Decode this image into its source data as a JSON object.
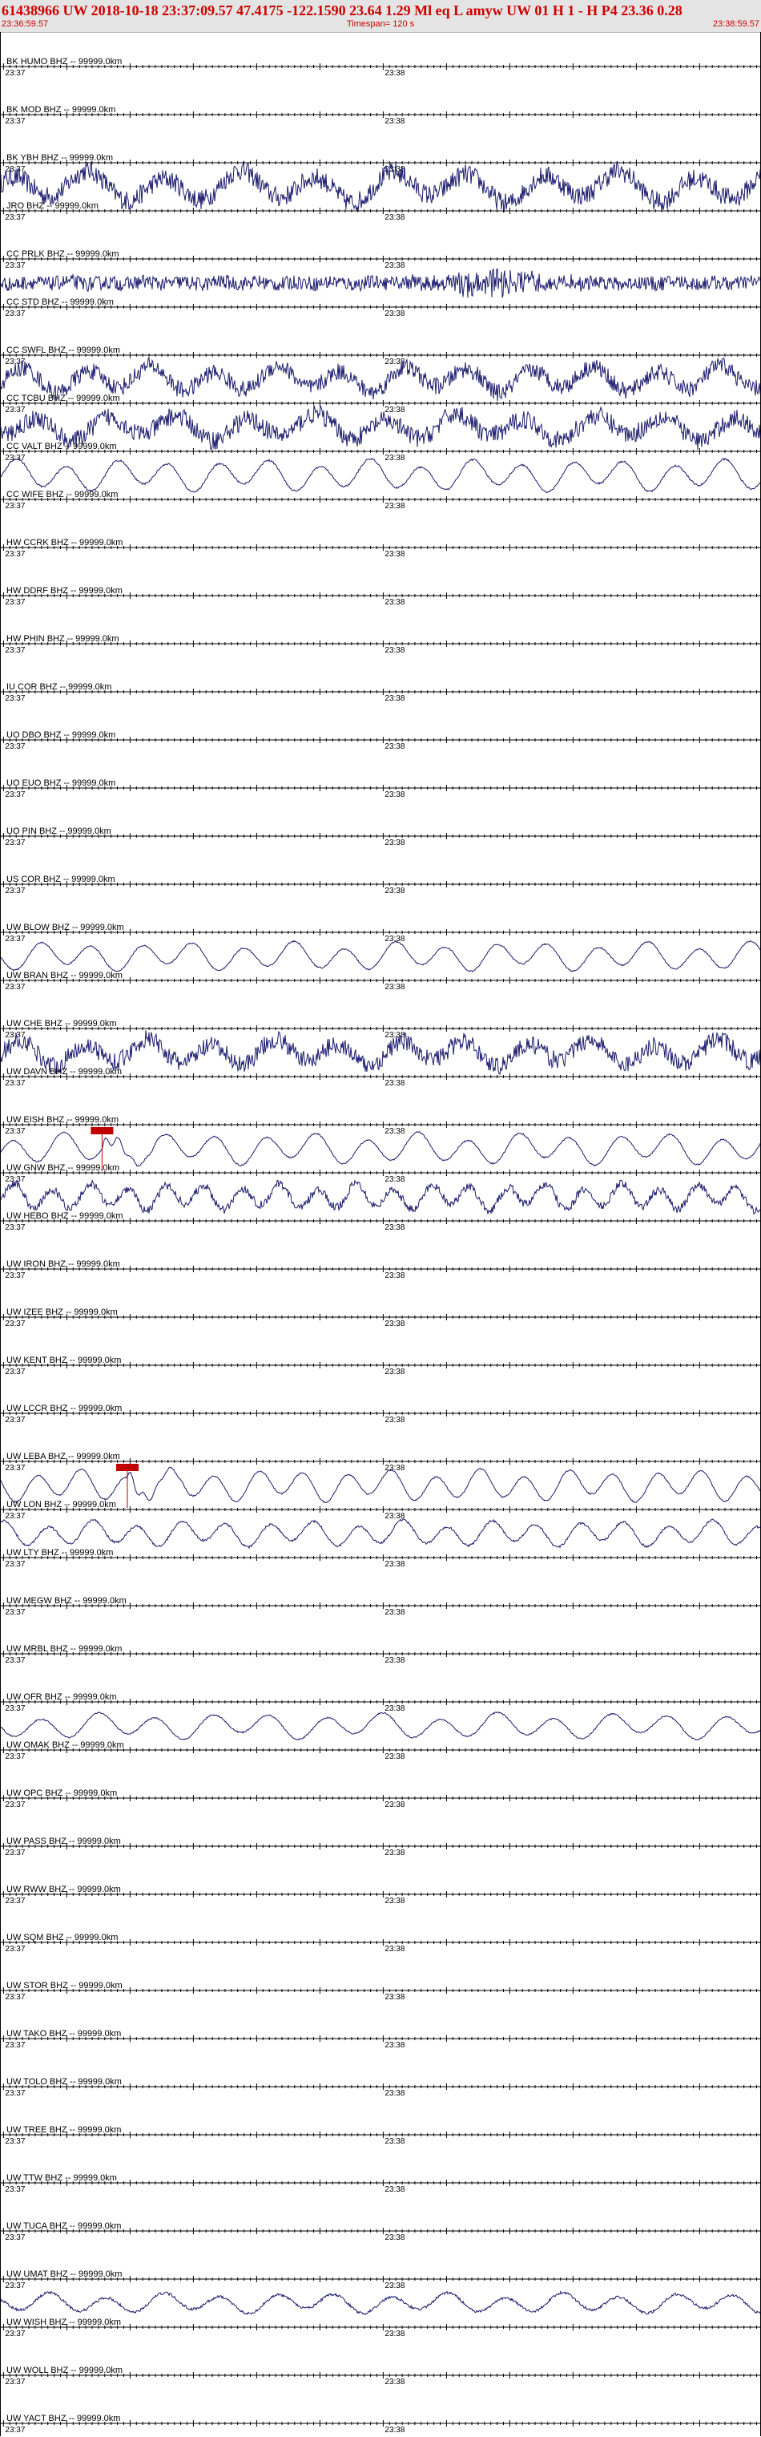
{
  "header": {
    "event_line": "61438966 UW 2018-10-18 23:37:09.57   47.4175 -122.1590  23.64  1.29 Ml  eq  L amyw    UW 01  H   1  -  H P4   23.36  0.28",
    "start_time": "23:36:59.57",
    "timespan": "Timespan= 120 s",
    "end_time": "23:38:59.57"
  },
  "colors": {
    "header_text": "#d00000",
    "header_bg": "#e4e4e4",
    "trace": "#1c1c6e",
    "axis": "#000000",
    "pick": "#c00000"
  },
  "chart_data": {
    "type": "line",
    "title": "61438966 UW 2018-10-18 23:37:09.57",
    "x_axis": {
      "start": "23:36:59.57",
      "end": "23:38:59.57",
      "span_seconds": 120,
      "labels": [
        {
          "text": "23:37",
          "t": 0.43
        },
        {
          "text": "23:38",
          "t": 60.43
        }
      ]
    },
    "grid": false,
    "trace_style": {
      "BK.YBH.BHZ": {
        "amp": 0.55,
        "period": 12,
        "noise": 0.45
      },
      "CC.PR05.BHZ": {
        "amp": 0.05,
        "period": 6,
        "noise": 0.32,
        "burst_at": 78,
        "burst_amp": 0.85
      },
      "CC.SWFL.BHZ": {
        "amp": 0.45,
        "period": 10,
        "noise": 0.38
      },
      "CC.TCBU.BHZ": {
        "amp": 0.45,
        "period": 11,
        "noise": 0.42
      },
      "CC.VALT.BHZ": {
        "amp": 0.55,
        "period": 8,
        "noise": 0.04
      },
      "UW.BLOW.BHZ": {
        "amp": 0.5,
        "period": 8,
        "noise": 0.03
      },
      "UW.CHE.BHZ": {
        "amp": 0.45,
        "period": 10,
        "noise": 0.4
      },
      "UW.EISH.BHZ": {
        "amp": 0.55,
        "period": 8,
        "noise": 0.03,
        "pick_at": 16
      },
      "UW.GNW.BHZ": {
        "amp": 0.45,
        "period": 6,
        "noise": 0.18
      },
      "UW.LEBA.BHZ": {
        "amp": 0.55,
        "period": 7,
        "noise": 0.03,
        "pick_at": 20
      },
      "UW.LON.BHZ": {
        "amp": 0.45,
        "period": 7,
        "noise": 0.05
      },
      "UW.OFR.BHZ": {
        "amp": 0.45,
        "period": 9,
        "noise": 0.03
      },
      "UW.UMAT.BHZ": {
        "amp": 0.35,
        "period": 9,
        "noise": 0.06
      }
    },
    "channels": [
      {
        "id": "BK.HUMO.BHZ",
        "label": "BK HUMO BHZ -- 99999.0km"
      },
      {
        "id": "BK.MOD.BHZ",
        "label": "BK MOD BHZ -- 99999.0km"
      },
      {
        "id": "BK.YBH.BHZ",
        "label": "BK YBH BHZ -- 99999.0km"
      },
      {
        "id": "BK.JRO.BHZ",
        "label": "JRO BHZ -- 99999.0km"
      },
      {
        "id": "CC.PR05.BHZ",
        "label": "CC PRLK BHZ -- 99999.0km"
      },
      {
        "id": "CC.STD.BHZ",
        "label": "CC STD BHZ -- 99999.0km"
      },
      {
        "id": "CC.SWFL.BHZ",
        "label": "CC SWFL BHZ -- 99999.0km"
      },
      {
        "id": "CC.TCBU.BHZ",
        "label": "CC TCBU BHZ -- 99999.0km"
      },
      {
        "id": "CC.VALT.BHZ",
        "label": "CC VALT BHZ -- 99999.0km"
      },
      {
        "id": "CC.WIFE.BHZ",
        "label": "CC WIFE BHZ -- 99999.0km"
      },
      {
        "id": "HW.CCRK.BHZ",
        "label": "HW CCRK BHZ -- 99999.0km"
      },
      {
        "id": "HW.DDRF.BHZ",
        "label": "HW DDRF BHZ -- 99999.0km"
      },
      {
        "id": "HW.PHIN.BHZ",
        "label": "HW PHIN BHZ -- 99999.0km"
      },
      {
        "id": "IU.COR.BHZ",
        "label": "IU COR BHZ -- 99999.0km"
      },
      {
        "id": "UO.DBO.BHZ",
        "label": "UO DBO BHZ -- 99999.0km"
      },
      {
        "id": "UO.EUO.BHZ",
        "label": "UO EUO BHZ -- 99999.0km"
      },
      {
        "id": "UO.PIN.BHZ",
        "label": "UO PIN BHZ -- 99999.0km"
      },
      {
        "id": "US.COR.BHZ",
        "label": "US COR BHZ -- 99999.0km"
      },
      {
        "id": "UW.BLOW.BHZ",
        "label": "UW BLOW BHZ -- 99999.0km"
      },
      {
        "id": "UW.BRAN.BHZ",
        "label": "UW BRAN BHZ -- 99999.0km"
      },
      {
        "id": "UW.CHE.BHZ",
        "label": "UW CHE BHZ -- 99999.0km"
      },
      {
        "id": "UW.DAVN.BHZ",
        "label": "UW DAVN BHZ -- 99999.0km"
      },
      {
        "id": "UW.EISH.BHZ",
        "label": "UW EISH BHZ -- 99999.0km"
      },
      {
        "id": "UW.GNW.BHZ",
        "label": "UW GNW BHZ -- 99999.0km"
      },
      {
        "id": "UW.HEBO.BHZ",
        "label": "UW HEBO BHZ -- 99999.0km"
      },
      {
        "id": "UW.IRON.BHZ",
        "label": "UW IRON BHZ -- 99999.0km"
      },
      {
        "id": "UW.IZEE.BHZ",
        "label": "UW IZEE BHZ -- 99999.0km"
      },
      {
        "id": "UW.KENT.BHZ",
        "label": "UW KENT BHZ -- 99999.0km"
      },
      {
        "id": "UW.LCCR.BHZ",
        "label": "UW LCCR BHZ -- 99999.0km"
      },
      {
        "id": "UW.LEBA.BHZ",
        "label": "UW LEBA BHZ -- 99999.0km"
      },
      {
        "id": "UW.LON.BHZ",
        "label": "UW LON BHZ -- 99999.0km"
      },
      {
        "id": "UW.LTY.BHZ",
        "label": "UW LTY BHZ -- 99999.0km"
      },
      {
        "id": "UW.MEGW.BHZ",
        "label": "UW MEGW BHZ -- 99999.0km"
      },
      {
        "id": "UW.MRBL.BHZ",
        "label": "UW MRBL BHZ -- 99999.0km"
      },
      {
        "id": "UW.OFR.BHZ",
        "label": "UW OFR BHZ -- 99999.0km"
      },
      {
        "id": "UW.OMAK.BHZ",
        "label": "UW OMAK BHZ -- 99999.0km"
      },
      {
        "id": "UW.OPC.BHZ",
        "label": "UW OPC BHZ -- 99999.0km"
      },
      {
        "id": "UW.PASS.BHZ",
        "label": "UW PASS BHZ -- 99999.0km"
      },
      {
        "id": "UW.RWW.BHZ",
        "label": "UW RWW BHZ -- 99999.0km"
      },
      {
        "id": "UW.SQM.BHZ",
        "label": "UW SQM BHZ -- 99999.0km"
      },
      {
        "id": "UW.STOR.BHZ",
        "label": "UW STOR BHZ -- 99999.0km"
      },
      {
        "id": "UW.TAKO.BHZ",
        "label": "UW TAKO BHZ -- 99999.0km"
      },
      {
        "id": "UW.TOLO.BHZ",
        "label": "UW TOLO BHZ -- 99999.0km"
      },
      {
        "id": "UW.TREE.BHZ",
        "label": "UW TREE BHZ -- 99999.0km"
      },
      {
        "id": "UW.TTW.BHZ",
        "label": "UW TTW BHZ -- 99999.0km"
      },
      {
        "id": "UW.TUCA.BHZ",
        "label": "UW TUCA BHZ -- 99999.0km"
      },
      {
        "id": "UW.UMAT.BHZ",
        "label": "UW UMAT BHZ -- 99999.0km"
      },
      {
        "id": "UW.WISH.BHZ",
        "label": "UW WISH BHZ -- 99999.0km"
      },
      {
        "id": "UW.WOLL.BHZ",
        "label": "UW WOLL BHZ -- 99999.0km"
      },
      {
        "id": "UW.YACT.BHZ",
        "label": "UW YACT BHZ -- 99999.0km"
      }
    ]
  }
}
